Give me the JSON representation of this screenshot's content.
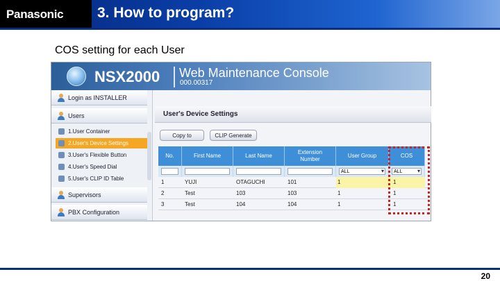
{
  "header": {
    "logo": "Panasonic",
    "title": "3. How to program?"
  },
  "subtitle": "COS setting for each User",
  "console": {
    "product": "NSX2000",
    "app_title": "Web Maintenance Console",
    "version": "000.00317",
    "login": "Login as INSTALLER",
    "sections": {
      "users": "Users",
      "supervisors": "Supervisors",
      "pbx": "PBX Configuration"
    },
    "menu": [
      "1.User Container",
      "2.User's Device Settings",
      "3.User's Flexible Button",
      "4.User's Speed Dial",
      "5.User's CLIP ID Table"
    ],
    "page_title": "User's Device Settings",
    "buttons": {
      "copy": "Copy to",
      "clip": "CLIP Generate"
    },
    "columns": [
      "No.",
      "First Name",
      "Last Name",
      "Extension Number",
      "User Group",
      "COS"
    ],
    "filters": {
      "user_group": "ALL",
      "cos": "ALL"
    },
    "rows": [
      {
        "no": "1",
        "first": "YUJI",
        "last": "OTAGUCHI",
        "ext": "101",
        "group": "1",
        "cos": "1"
      },
      {
        "no": "2",
        "first": "Test",
        "last": "103",
        "ext": "103",
        "group": "1",
        "cos": "1"
      },
      {
        "no": "3",
        "first": "Test",
        "last": "104",
        "ext": "104",
        "group": "1",
        "cos": "1"
      }
    ]
  },
  "page_number": "20"
}
